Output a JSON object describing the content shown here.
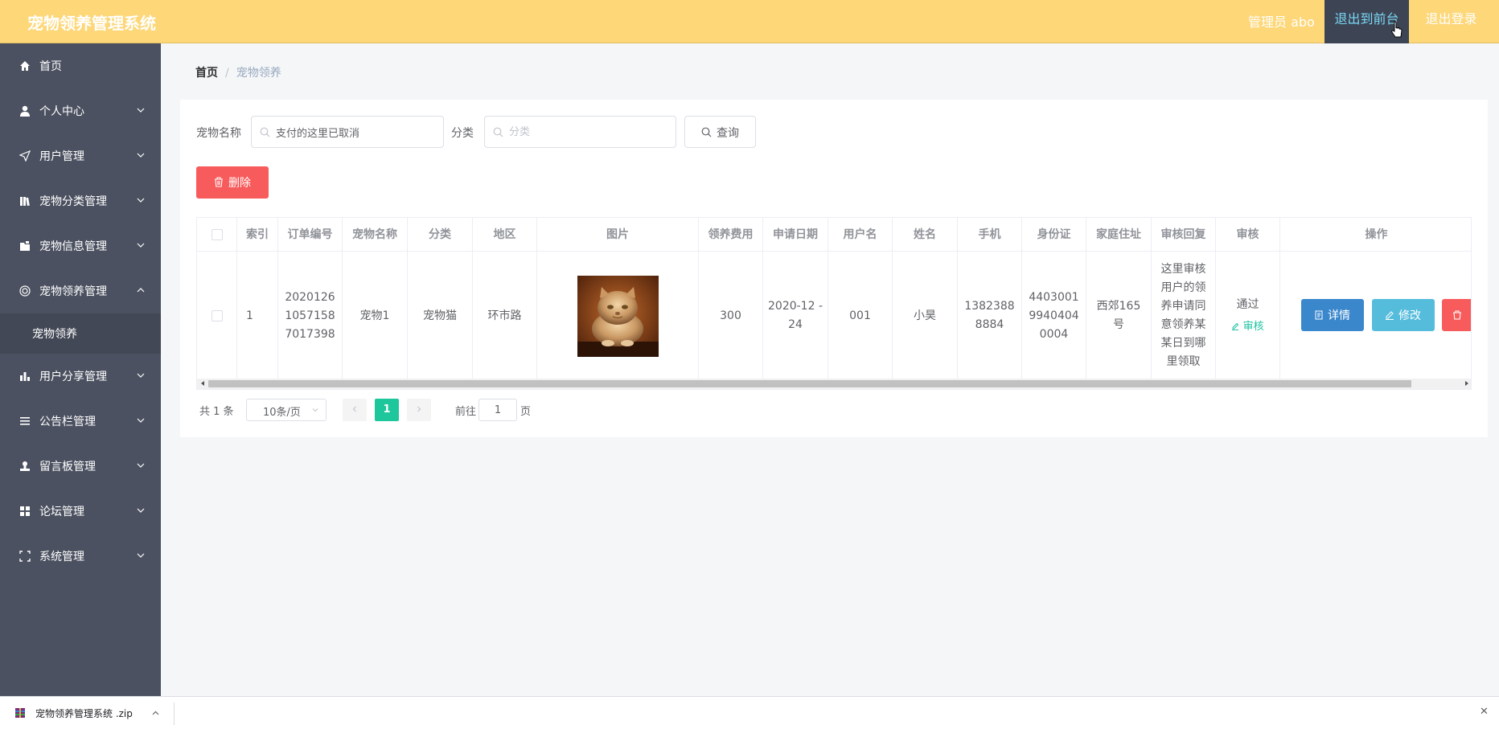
{
  "header": {
    "title": "宠物领养管理系统",
    "admin_label": "管理员 abo",
    "front_button": "退出到前台",
    "logout_button": "退出登录"
  },
  "sidebar": {
    "items": [
      {
        "label": "首页",
        "icon": "home-icon"
      },
      {
        "label": "个人中心",
        "icon": "user-icon"
      },
      {
        "label": "用户管理",
        "icon": "send-icon"
      },
      {
        "label": "宠物分类管理",
        "icon": "books-icon"
      },
      {
        "label": "宠物信息管理",
        "icon": "folder-icon"
      },
      {
        "label": "宠物领养管理",
        "icon": "shield-icon"
      },
      {
        "label": "宠物领养",
        "icon": ""
      },
      {
        "label": "用户分享管理",
        "icon": "bar-chart-icon"
      },
      {
        "label": "公告栏管理",
        "icon": "list-icon"
      },
      {
        "label": "留言板管理",
        "icon": "person-stamp-icon"
      },
      {
        "label": "论坛管理",
        "icon": "grid-icon"
      },
      {
        "label": "系统管理",
        "icon": "fullscreen-icon"
      }
    ]
  },
  "breadcrumb": {
    "home": "首页",
    "separator": "/",
    "current": "宠物领养"
  },
  "filters": {
    "pet_name_label": "宠物名称",
    "pet_name_value": "支付的这里已取消",
    "category_label": "分类",
    "category_placeholder": "分类",
    "query_button": "查询"
  },
  "toolbar": {
    "delete_button": "删除"
  },
  "table": {
    "columns": [
      "索引",
      "订单编号",
      "宠物名称",
      "分类",
      "地区",
      "图片",
      "领养费用",
      "申请日期",
      "用户名",
      "姓名",
      "手机",
      "身份证",
      "家庭住址",
      "审核回复",
      "审核",
      "操作"
    ],
    "rows": [
      {
        "index": "1",
        "order_no": "20201261057158 7017398",
        "pet_name": "宠物1",
        "category": "宠物猫",
        "region": "环市路",
        "fee": "300",
        "date": "2020-12 -24",
        "username": "001",
        "name": "小昊",
        "phone": "1382388 8884",
        "id_card": "4403001 9940404 0004",
        "address": "西郊165 号",
        "reply": "这里审核用户的领养申请同意领养某某日到哪里领取",
        "audit_status": "通过",
        "audit_link": "审核",
        "detail_button": "详情",
        "edit_button": "修改"
      }
    ]
  },
  "pagination": {
    "total": "共 1 条",
    "page_size": "10条/页",
    "current_page": "1",
    "goto_label": "前往",
    "goto_value": "1",
    "page_unit": "页"
  },
  "download_bar": {
    "file_name": "宠物领养管理系统 .zip",
    "close": "✕"
  },
  "colors": {
    "header_bg": "#fdd778",
    "sidebar_bg": "#4b5160",
    "accent": "#1ec69c",
    "danger": "#f85b5b",
    "detail_btn": "#3a87cc",
    "edit_btn": "#55bcdc"
  }
}
